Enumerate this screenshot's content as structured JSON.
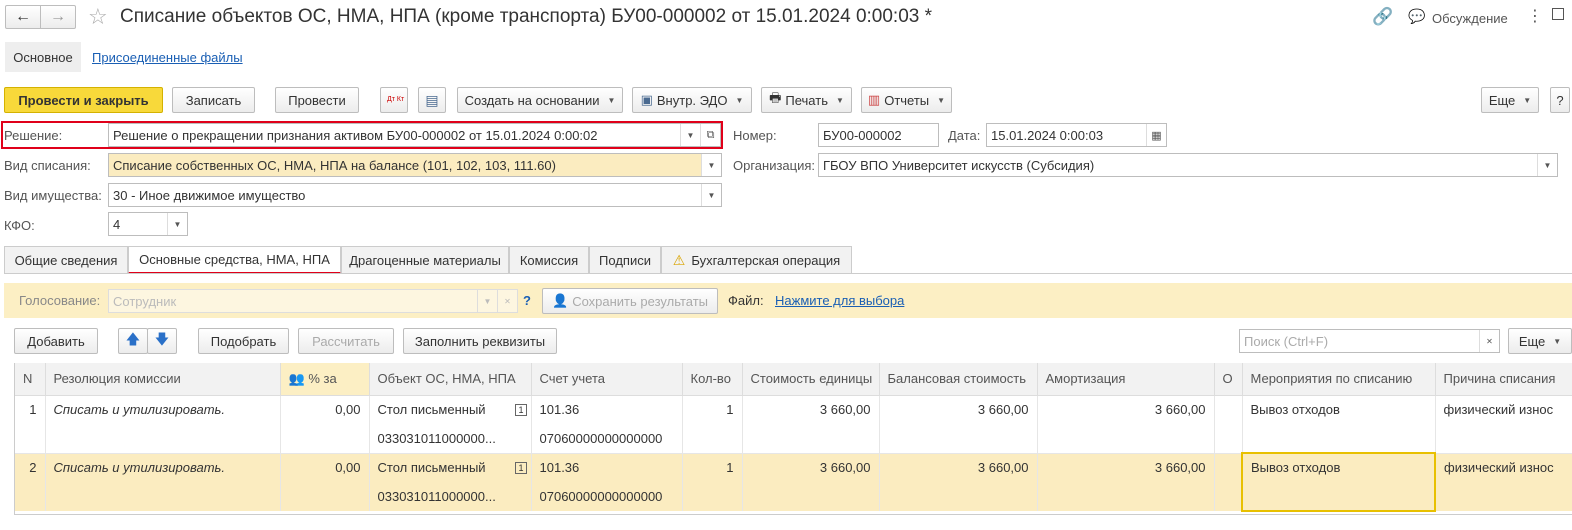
{
  "window": {
    "title": "Списание объектов ОС, НМА, НПА (кроме транспорта) БУ00-000002 от 15.01.2024 0:00:03 *",
    "discussion_label": "Обсуждение"
  },
  "nav_tabs": [
    "Основное",
    "Присоединенные файлы"
  ],
  "toolbar": {
    "post_close": "Провести и закрыть",
    "save": "Записать",
    "post": "Провести",
    "dtkt_icon_text": "Дт Кт",
    "create_based": "Создать на основании",
    "edo": "Внутр. ЭДО",
    "print": "Печать",
    "reports": "Отчеты",
    "more": "Еще",
    "help": "?"
  },
  "form": {
    "decision_label": "Решение:",
    "decision_value": "Решение о прекращении признания активом БУ00-000002 от 15.01.2024 0:00:02",
    "write_off_type_label": "Вид списания:",
    "write_off_type_value": "Списание собственных ОС, НМА, НПА на балансе (101, 102, 103, 111.60)",
    "property_type_label": "Вид имущества:",
    "property_type_value": "30 - Иное движимое имущество",
    "kfo_label": "КФО:",
    "kfo_value": "4",
    "number_label": "Номер:",
    "number_value": "БУ00-000002",
    "date_label": "Дата:",
    "date_value": "15.01.2024  0:00:03",
    "org_label": "Организация:",
    "org_value": "ГБОУ ВПО Университет искусств (Субсидия)"
  },
  "tabs": [
    "Общие сведения",
    "Основные средства, НМА, НПА",
    "Драгоценные материалы",
    "Комиссия",
    "Подписи",
    "Бухгалтерская операция"
  ],
  "voting": {
    "label": "Голосование:",
    "placeholder": "Сотрудник",
    "help": "?",
    "save_results": "Сохранить результаты",
    "file_label": "Файл:",
    "file_link": "Нажмите для выбора"
  },
  "table_toolbar": {
    "add": "Добавить",
    "pick": "Подобрать",
    "calculate": "Рассчитать",
    "fill": "Заполнить реквизиты",
    "search_placeholder": "Поиск (Ctrl+F)",
    "more": "Еще"
  },
  "table": {
    "headers": [
      "N",
      "Резолюция комиссии",
      "% за",
      "Объект ОС, НМА, НПА",
      "Счет учета",
      "Кол-во",
      "Стоимость единицы",
      "Балансовая стоимость",
      "Амортизация",
      "О",
      "Мероприятия по списанию",
      "Причина списания"
    ],
    "rows": [
      {
        "n": "1",
        "resolution": "Списать и утилизировать.",
        "pct": "0,00",
        "object": "Стол письменный",
        "object_code": "033031011000000...",
        "account": "101.36",
        "account_code": "07060000000000000",
        "qty": "1",
        "unit_cost": "3 660,00",
        "balance": "3 660,00",
        "amort": "3 660,00",
        "event": "Вывоз отходов",
        "reason": "физический износ"
      },
      {
        "n": "2",
        "resolution": "Списать и утилизировать.",
        "pct": "0,00",
        "object": "Стол письменный",
        "object_code": "033031011000000...",
        "account": "101.36",
        "account_code": "07060000000000000",
        "qty": "1",
        "unit_cost": "3 660,00",
        "balance": "3 660,00",
        "amort": "3 660,00",
        "event": "Вывоз отходов",
        "reason": "физический износ"
      }
    ]
  },
  "colors": {
    "accent": "#f8d93a",
    "selection": "#fbecc0",
    "highlight_border": "#e0001a",
    "link": "#1a5fb4"
  }
}
